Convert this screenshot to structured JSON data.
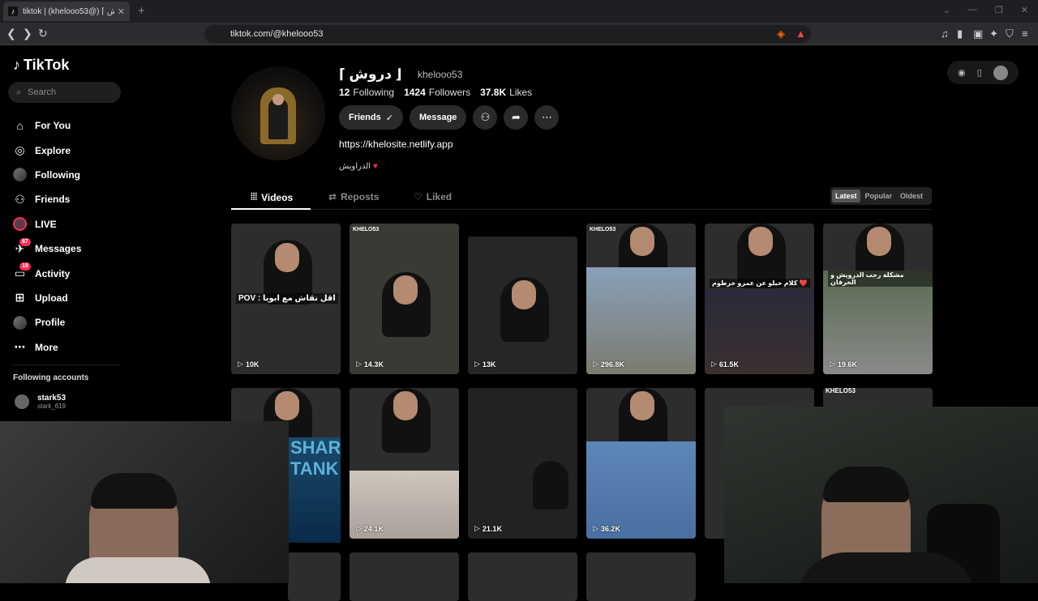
{
  "browser": {
    "tab_title": "tiktok | (khelooo53@) ⌈ دروش ⌋",
    "url": "tiktok.com/@khelooo53"
  },
  "sidebar": {
    "logo": "TikTok",
    "search_placeholder": "Search",
    "items": [
      {
        "label": "For You",
        "icon": "home-icon"
      },
      {
        "label": "Explore",
        "icon": "compass-icon"
      },
      {
        "label": "Following",
        "icon": "avatar-icon"
      },
      {
        "label": "Friends",
        "icon": "friends-icon"
      },
      {
        "label": "LIVE",
        "icon": "live-icon"
      },
      {
        "label": "Messages",
        "icon": "messages-icon",
        "badge": "87"
      },
      {
        "label": "Activity",
        "icon": "activity-icon",
        "badge": "19"
      },
      {
        "label": "Upload",
        "icon": "upload-icon"
      },
      {
        "label": "Profile",
        "icon": "profile-icon"
      },
      {
        "label": "More",
        "icon": "more-icon"
      }
    ],
    "following_accounts_title": "Following accounts",
    "accounts": [
      {
        "name": "stark53",
        "handle": "stark_619"
      }
    ]
  },
  "profile": {
    "display_name": "⌈ دروش ⌋",
    "username": "khelooo53",
    "following_count": "12",
    "following_label": "Following",
    "followers_count": "1424",
    "followers_label": "Followers",
    "likes_count": "37.8K",
    "likes_label": "Likes",
    "friends_btn": "Friends",
    "message_btn": "Message",
    "link": "https://khelosite.netlify.app",
    "bio": "الدراويش"
  },
  "tabs": {
    "videos": "Videos",
    "reposts": "Reposts",
    "liked": "Liked"
  },
  "sort": {
    "latest": "Latest",
    "popular": "Popular",
    "oldest": "Oldest"
  },
  "videos": [
    {
      "views": "10K",
      "overlay": "POV : اقل نقاش مع ابويا"
    },
    {
      "views": "14.3K",
      "tag": "KHELO53"
    },
    {
      "views": "13K"
    },
    {
      "views": "296.8K",
      "tag": "KHELO53"
    },
    {
      "views": "61.5K",
      "overlay": "كلام خيلو عن عمرو خرطوم ❤️"
    },
    {
      "views": "19.6K",
      "overlay": "مشكلة رجب الدرويش و الخرفان"
    },
    {
      "views": ""
    },
    {
      "views": "24.1K"
    },
    {
      "views": "21.1K"
    },
    {
      "views": "36.2K"
    },
    {
      "views": ""
    },
    {
      "views": ""
    }
  ],
  "overlay_tags": {
    "right_tag": "KHELO53",
    "shark_text": "SHARK TANK"
  }
}
